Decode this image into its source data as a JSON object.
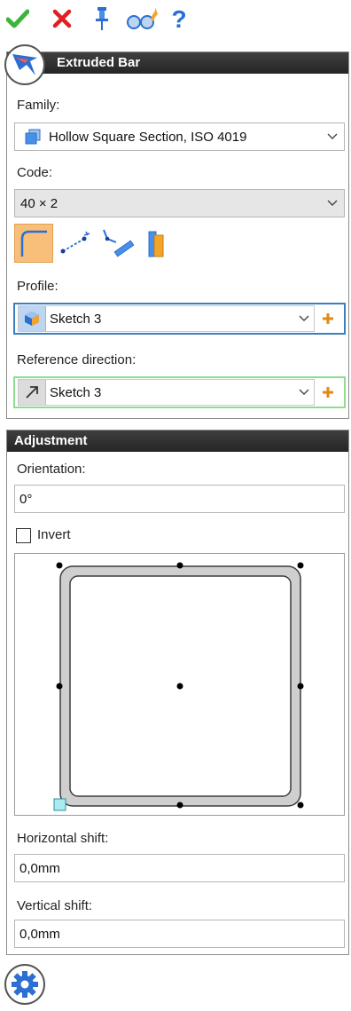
{
  "toolbar": {
    "ok": "ok-check-icon",
    "cancel": "cancel-x-icon",
    "pin": "pin-icon",
    "preview": "preview-glasses-icon",
    "help": "help-question-icon"
  },
  "extruded_bar": {
    "title": "Extruded Bar",
    "family_label": "Family:",
    "family_value": "Hollow Square Section, ISO 4019",
    "code_label": "Code:",
    "code_value": "40 × 2",
    "profile_label": "Profile:",
    "profile_value": "Sketch 3",
    "ref_dir_label": "Reference direction:",
    "ref_dir_value": "Sketch 3"
  },
  "adjustment": {
    "title": "Adjustment",
    "orientation_label": "Orientation:",
    "orientation_value": "0°",
    "invert_label": "Invert",
    "invert_checked": false,
    "hshift_label": "Horizontal shift:",
    "hshift_value": "0,0mm",
    "vshift_label": "Vertical shift:",
    "vshift_value": "0,0mm"
  },
  "colors": {
    "profile_border": "#3c7fc0",
    "ref_border": "#8fdc8f",
    "accent_orange": "#f7bf7a",
    "check_green": "#3cb43c",
    "cancel_red": "#e02020",
    "blue": "#2a6fd1"
  }
}
